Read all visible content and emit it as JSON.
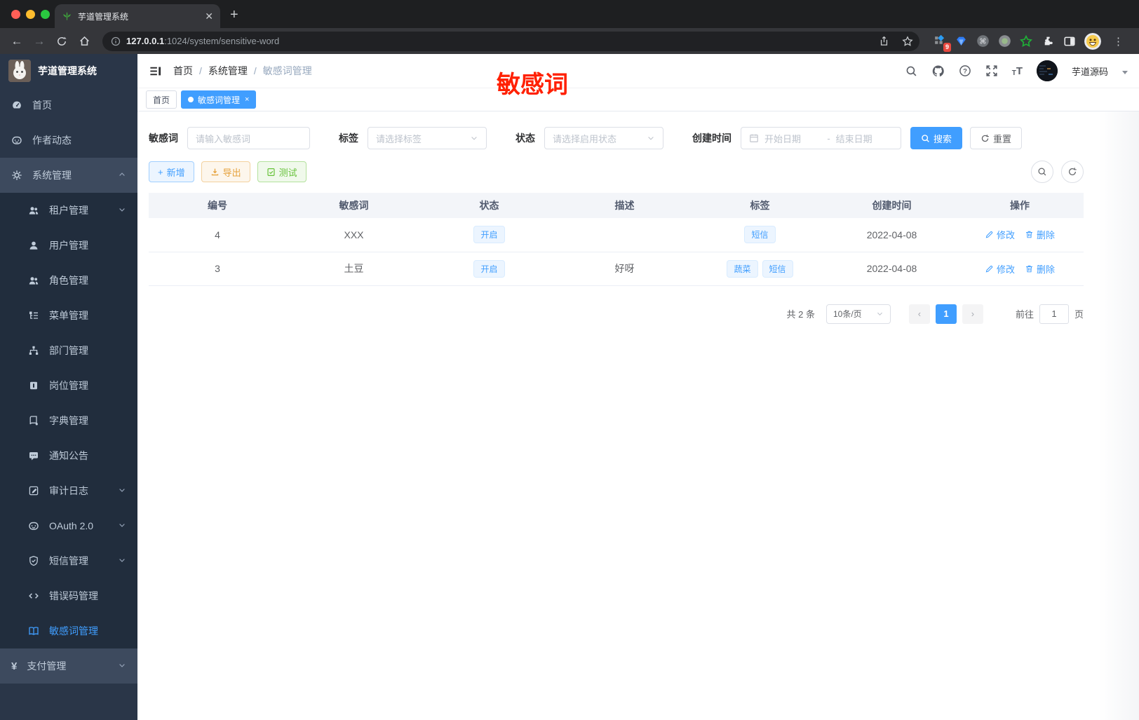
{
  "colors": {
    "accent": "#409eff",
    "success": "#67c23a",
    "warning": "#e6a23c",
    "annotation_red": "#ff2000",
    "sidebar_bg": "#2a3648",
    "sidebar_sub_bg": "#212d3d",
    "sidebar_section_bg": "#3d4a5e"
  },
  "icon_names": [
    "leaf-favicon",
    "back-icon",
    "forward-icon",
    "reload-icon",
    "home-icon",
    "info-icon",
    "share-icon",
    "star-icon",
    "grid-extension-icon",
    "gem-extension-icon",
    "cmd-extension-icon",
    "record-extension-icon",
    "green-star-extension-icon",
    "puzzle-icon",
    "side-panel-icon",
    "emoji-profile-icon",
    "kebab-menu-icon",
    "collapse-sidebar-icon",
    "search-icon",
    "github-icon",
    "help-icon",
    "fullscreen-icon",
    "font-size-icon",
    "calendar-icon",
    "plus-icon",
    "download-icon",
    "test-doc-icon",
    "refresh-icon",
    "edit-icon",
    "delete-icon",
    "chevron-down-icon",
    "chevron-up-icon"
  ],
  "browser": {
    "tab_title": "芋道管理系统",
    "url_host": "127.0.0.1",
    "url_rest": ":1024/system/sensitive-word",
    "ext_badge": "9"
  },
  "annotation": "敏感词",
  "sidebar": {
    "app_title": "芋道管理系统",
    "items": [
      {
        "key": "home",
        "label": "首页",
        "icon": "dashboard",
        "level": 1
      },
      {
        "key": "author-feed",
        "label": "作者动态",
        "icon": "face",
        "level": 1
      },
      {
        "key": "system-mgmt",
        "label": "系统管理",
        "icon": "gear",
        "level": 1,
        "chevron": "up",
        "section": true
      },
      {
        "key": "tenant-mgmt",
        "label": "租户管理",
        "icon": "users",
        "level": 2,
        "chevron": "down"
      },
      {
        "key": "user-mgmt",
        "label": "用户管理",
        "icon": "user",
        "level": 2
      },
      {
        "key": "role-mgmt",
        "label": "角色管理",
        "icon": "users",
        "level": 2
      },
      {
        "key": "menu-mgmt",
        "label": "菜单管理",
        "icon": "tree",
        "level": 2
      },
      {
        "key": "dept-mgmt",
        "label": "部门管理",
        "icon": "org",
        "level": 2
      },
      {
        "key": "post-mgmt",
        "label": "岗位管理",
        "icon": "badge",
        "level": 2
      },
      {
        "key": "dict-mgmt",
        "label": "字典管理",
        "icon": "book",
        "level": 2
      },
      {
        "key": "notice-mgmt",
        "label": "通知公告",
        "icon": "comment",
        "level": 2
      },
      {
        "key": "audit-log",
        "label": "审计日志",
        "icon": "log",
        "level": 2,
        "chevron": "down"
      },
      {
        "key": "oauth2",
        "label": "OAuth 2.0",
        "icon": "face",
        "level": 2,
        "chevron": "down"
      },
      {
        "key": "sms-mgmt",
        "label": "短信管理",
        "icon": "shield",
        "level": 2,
        "chevron": "down"
      },
      {
        "key": "error-code-mgmt",
        "label": "错误码管理",
        "icon": "code",
        "level": 2
      },
      {
        "key": "sensitive-word-mgmt",
        "label": "敏感词管理",
        "icon": "openbook",
        "level": 2,
        "active": true
      },
      {
        "key": "pay-mgmt",
        "label": "支付管理",
        "icon": "yen",
        "level": 1,
        "chevron": "down",
        "section": true
      }
    ]
  },
  "header": {
    "breadcrumb": [
      "首页",
      "系统管理",
      "敏感词管理"
    ],
    "user": "芋道源码"
  },
  "tags": [
    {
      "label": "首页",
      "active": false,
      "closable": false
    },
    {
      "label": "敏感词管理",
      "active": true,
      "closable": true
    }
  ],
  "filters": {
    "word": {
      "label": "敏感词",
      "placeholder": "请输入敏感词"
    },
    "tag": {
      "label": "标签",
      "placeholder": "请选择标签"
    },
    "status": {
      "label": "状态",
      "placeholder": "请选择启用状态"
    },
    "created": {
      "label": "创建时间",
      "start": "开始日期",
      "sep": "-",
      "end": "结束日期"
    },
    "search": "搜索",
    "reset": "重置"
  },
  "toolbar": {
    "add": "新增",
    "export": "导出",
    "test": "测试"
  },
  "table": {
    "columns": [
      "编号",
      "敏感词",
      "状态",
      "描述",
      "标签",
      "创建时间",
      "操作"
    ],
    "ops": [
      "修改",
      "删除"
    ],
    "rows": [
      {
        "id": "4",
        "word": "XXX",
        "status": "开启",
        "desc": "",
        "tags": [
          "短信"
        ],
        "created": "2022-04-08"
      },
      {
        "id": "3",
        "word": "土豆",
        "status": "开启",
        "desc": "好呀",
        "tags": [
          "蔬菜",
          "短信"
        ],
        "created": "2022-04-08"
      }
    ]
  },
  "pagination": {
    "total": "共 2 条",
    "page_size": "10条/页",
    "prev": "‹",
    "current": "1",
    "next": "›",
    "goto_label": "前往",
    "goto_value": "1",
    "goto_unit": "页"
  }
}
